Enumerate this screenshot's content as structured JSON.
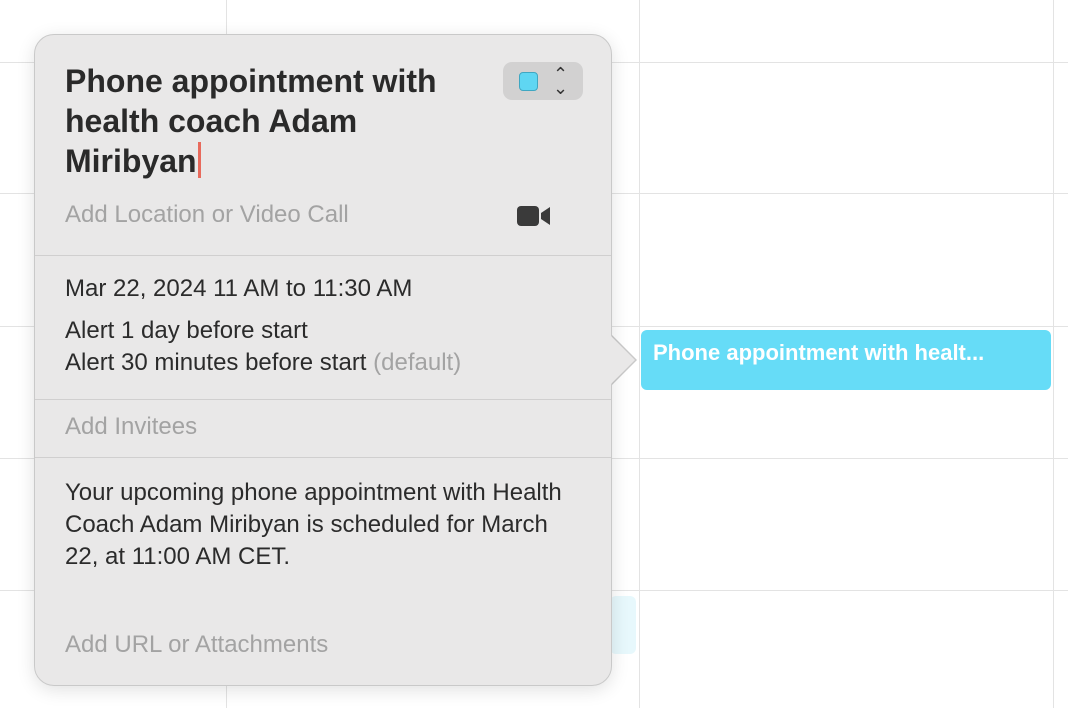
{
  "event": {
    "title": "Phone appointment with health coach Adam Miribyan",
    "chip_label": "Phone appointment with healt...",
    "color": "#66dcf7",
    "location_placeholder": "Add Location or Video Call",
    "video_icon": "video-camera-icon",
    "date_time": "Mar 22, 2024  11 AM to 11:30 AM",
    "alerts": [
      {
        "text": "Alert 1 day before start",
        "note": ""
      },
      {
        "text": "Alert 30 minutes before start",
        "note": "(default)"
      }
    ],
    "invitees_placeholder": "Add Invitees",
    "notes": "Your upcoming phone appointment with Health Coach Adam Miribyan is scheduled for March 22, at 11:00 AM CET.",
    "url_placeholder": "Add URL or Attachments"
  }
}
